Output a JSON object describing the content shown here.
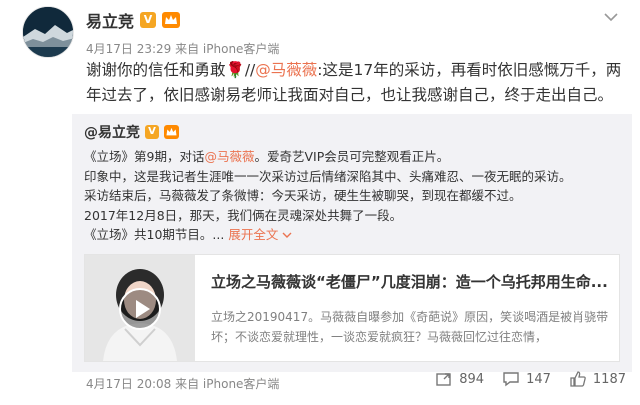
{
  "header": {
    "author": "易立竞",
    "meta": "4月17日 23:29 来自 iPhone客户端"
  },
  "post": {
    "text_before": "谢谢你的信任和勇敢",
    "rose": "🌹",
    "repost_prefix": "//",
    "mention": "@马薇薇",
    "text_after": ":这是17年的采访，再看时依旧感慨万千，两年过去了，依旧感谢易老师让我面对自己，也让我感谢自己，终于走出自己。"
  },
  "repost": {
    "author": "@易立竞",
    "line1_prefix": "《立场》第9期，对话",
    "line1_mention": "@马薇薇",
    "line1_suffix": "。爱奇艺VIP会员可完整观看正片。",
    "line2": "印象中，这是我记者生涯唯一一次采访过后情绪深陷其中、头痛难忍、一夜无眠的采访。",
    "line3": "采访结束后，马薇薇发了条微博：今天采访，硬生生被聊哭，到现在都缓不过。",
    "line4": "2017年12月8日，那天，我们俩在灵魂深处共舞了一段。",
    "line5_prefix": "《立场》共10期节目。...",
    "expand": "展开全文",
    "expand_icon": "chevron-down",
    "media": {
      "title": "立场之马薇薇谈“老僵尸”几度泪崩：造一个乌托邦用生命...",
      "desc": "立场之20190417。马薇薇自曝参加《奇葩说》原因，笑谈喝酒是被肖骁带坏；不谈恋爱就理性，一谈恋爱就疯狂？马薇薇回忆过往恋情，"
    }
  },
  "footer": {
    "meta": "4月17日 20:08 来自 iPhone客户端",
    "repost_count": "894",
    "comment_count": "147",
    "like_count": "1187"
  },
  "colors": {
    "link": "#eb7350",
    "repost_bg": "#f2f2f5",
    "badge_v": "#f5a623"
  }
}
